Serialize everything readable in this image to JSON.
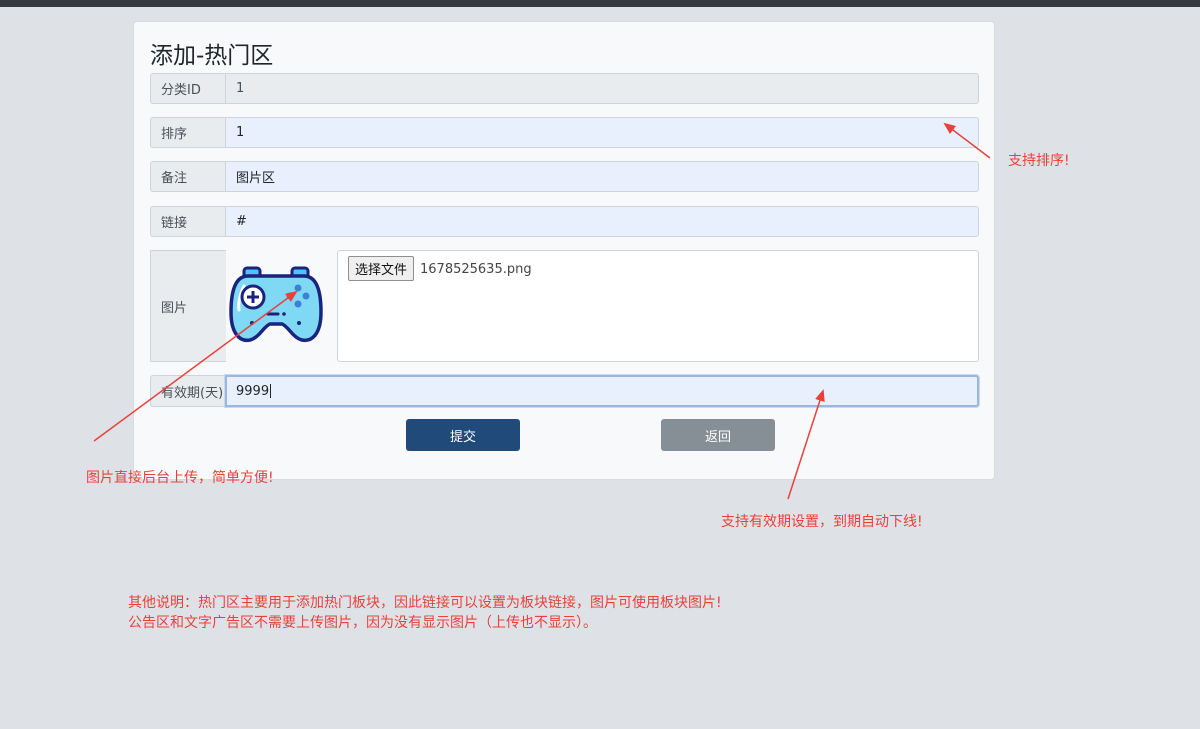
{
  "page_title": "添加-热门区",
  "fields": {
    "category_id": {
      "label": "分类ID",
      "value": "1"
    },
    "sort": {
      "label": "排序",
      "value": "1"
    },
    "remark": {
      "label": "备注",
      "value": "图片区"
    },
    "link": {
      "label": "链接",
      "value": "#"
    },
    "image": {
      "label": "图片",
      "file_button": "选择文件",
      "file_name": "1678525635.png",
      "preview_icon": "gamepad-icon"
    },
    "validity": {
      "label": "有效期(天)",
      "value": "9999"
    }
  },
  "buttons": {
    "submit": "提交",
    "back": "返回"
  },
  "annotations": {
    "sort_note": "支持排序!",
    "upload_note": "图片直接后台上传，简单方便!",
    "validity_note": "支持有效期设置，到期自动下线!",
    "other_line1": "其他说明：热门区主要用于添加热门板块，因此链接可以设置为板块链接，图片可使用板块图片!",
    "other_line2": "公告区和文字广告区不需要上传图片，因为没有显示图片（上传也不显示）。"
  },
  "colors": {
    "primary": "#1f4a7a",
    "secondary": "#868e96",
    "annotation": "#e8413c",
    "autofill": "#e8f0fe"
  }
}
